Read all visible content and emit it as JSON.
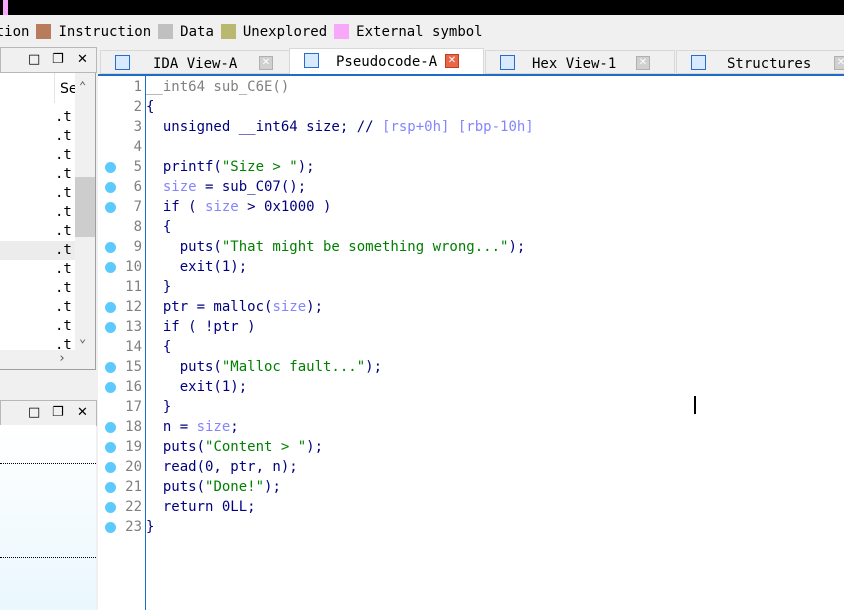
{
  "legend": [
    {
      "label": "Function",
      "color": "#f0f0f0"
    },
    {
      "label": "Instruction",
      "color": "#b87c5c"
    },
    {
      "label": "Data",
      "color": "#c0c0c0"
    },
    {
      "label": "Unexplored",
      "color": "#b8b870"
    },
    {
      "label": "External symbol",
      "color": "#f8a8f8"
    }
  ],
  "left_panel": {
    "column_header": "Se",
    "rows": [
      ".t",
      ".t",
      ".t",
      ".t",
      ".t",
      ".t",
      ".t",
      ".t",
      ".t",
      ".t",
      ".t",
      ".t",
      ".t"
    ],
    "selected_row": 7
  },
  "window_buttons": {
    "maximize": "□",
    "restore": "❐",
    "close": "✕"
  },
  "tabs": [
    {
      "label": "IDA View-A",
      "icon": "disassembly-icon",
      "active": false
    },
    {
      "label": "Pseudocode-A",
      "icon": "pseudocode-icon",
      "active": true
    },
    {
      "label": "Hex View-1",
      "icon": "hex-icon",
      "active": false
    },
    {
      "label": "Structures",
      "icon": "structures-icon",
      "active": false
    }
  ],
  "code": [
    {
      "n": "1",
      "bp": false,
      "t": [
        [
          "head",
          "__int64 sub_C6E()"
        ]
      ]
    },
    {
      "n": "2",
      "bp": false,
      "t": [
        [
          "kw",
          "{"
        ]
      ]
    },
    {
      "n": "3",
      "bp": false,
      "t": [
        [
          "kw",
          "  unsigned __int64 size; // "
        ],
        [
          "cmt",
          "[rsp+0h] [rbp-10h]"
        ]
      ]
    },
    {
      "n": "4",
      "bp": false,
      "t": []
    },
    {
      "n": "5",
      "bp": true,
      "t": [
        [
          "kw",
          "  printf("
        ],
        [
          "str",
          "\"Size > \""
        ],
        [
          "kw",
          ");"
        ]
      ]
    },
    {
      "n": "6",
      "bp": true,
      "t": [
        [
          "kw",
          "  "
        ],
        [
          "var",
          "size"
        ],
        [
          "kw",
          " = sub_C07();"
        ]
      ]
    },
    {
      "n": "7",
      "bp": true,
      "t": [
        [
          "kw",
          "  if ( "
        ],
        [
          "var",
          "size"
        ],
        [
          "kw",
          " > 0x1000 )"
        ]
      ]
    },
    {
      "n": "8",
      "bp": false,
      "t": [
        [
          "kw",
          "  {"
        ]
      ]
    },
    {
      "n": "9",
      "bp": true,
      "t": [
        [
          "kw",
          "    puts("
        ],
        [
          "str",
          "\"That might be something wrong...\""
        ],
        [
          "kw",
          ");"
        ]
      ]
    },
    {
      "n": "10",
      "bp": true,
      "t": [
        [
          "kw",
          "    exit(1);"
        ]
      ]
    },
    {
      "n": "11",
      "bp": false,
      "t": [
        [
          "kw",
          "  }"
        ]
      ]
    },
    {
      "n": "12",
      "bp": true,
      "t": [
        [
          "kw",
          "  ptr = malloc("
        ],
        [
          "var",
          "size"
        ],
        [
          "kw",
          ");"
        ]
      ]
    },
    {
      "n": "13",
      "bp": true,
      "t": [
        [
          "kw",
          "  if ( !ptr )"
        ]
      ]
    },
    {
      "n": "14",
      "bp": false,
      "t": [
        [
          "kw",
          "  {"
        ]
      ]
    },
    {
      "n": "15",
      "bp": true,
      "t": [
        [
          "kw",
          "    puts("
        ],
        [
          "str",
          "\"Malloc fault...\""
        ],
        [
          "kw",
          ");"
        ]
      ]
    },
    {
      "n": "16",
      "bp": true,
      "t": [
        [
          "kw",
          "    exit(1);"
        ]
      ]
    },
    {
      "n": "17",
      "bp": false,
      "t": [
        [
          "kw",
          "  }"
        ]
      ]
    },
    {
      "n": "18",
      "bp": true,
      "t": [
        [
          "kw",
          "  n = "
        ],
        [
          "var",
          "size"
        ],
        [
          "kw",
          ";"
        ]
      ]
    },
    {
      "n": "19",
      "bp": true,
      "t": [
        [
          "kw",
          "  puts("
        ],
        [
          "str",
          "\"Content > \""
        ],
        [
          "kw",
          ");"
        ]
      ]
    },
    {
      "n": "20",
      "bp": true,
      "t": [
        [
          "kw",
          "  read(0, ptr, n);"
        ]
      ]
    },
    {
      "n": "21",
      "bp": true,
      "t": [
        [
          "kw",
          "  puts("
        ],
        [
          "str",
          "\"Done!\""
        ],
        [
          "kw",
          ");"
        ]
      ]
    },
    {
      "n": "22",
      "bp": true,
      "t": [
        [
          "kw",
          "  return 0LL;"
        ]
      ]
    },
    {
      "n": "23",
      "bp": true,
      "t": [
        [
          "kw",
          "}"
        ]
      ]
    }
  ]
}
